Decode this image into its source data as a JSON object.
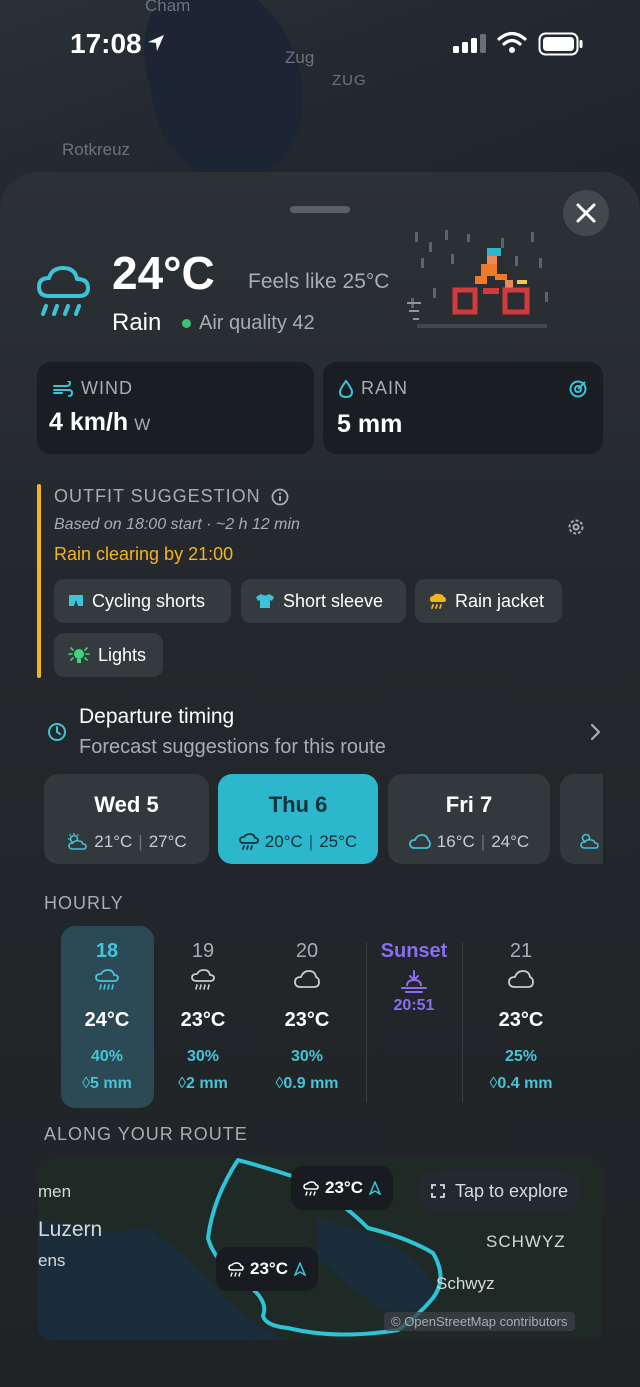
{
  "status_bar": {
    "time": "17:08"
  },
  "background_map": {
    "labels": [
      "Cham",
      "Zug",
      "ZUG",
      "Rotkreuz"
    ]
  },
  "current": {
    "temperature": "24°C",
    "feels_like": "Feels like 25°C",
    "condition": "Rain",
    "air_quality": "Air quality 42",
    "icon": "rain-cloud-icon"
  },
  "wind": {
    "label": "WIND",
    "value": "4 km/h",
    "direction": "W"
  },
  "rain": {
    "label": "RAIN",
    "value": "5 mm"
  },
  "outfit": {
    "title": "OUTFIT SUGGESTION",
    "subtitle": "Based on 18:00 start · ~2 h 12 min",
    "warning": "Rain clearing by 21:00",
    "chips": [
      {
        "label": "Cycling shorts",
        "icon": "shorts-icon"
      },
      {
        "label": "Short sleeve",
        "icon": "tshirt-icon"
      },
      {
        "label": "Rain jacket",
        "icon": "rain-jacket-icon"
      },
      {
        "label": "Lights",
        "icon": "light-icon"
      }
    ]
  },
  "departure": {
    "title": "Departure timing",
    "subtitle": "Forecast suggestions for this route"
  },
  "days": [
    {
      "name": "Wed 5",
      "low": "21°C",
      "high": "27°C",
      "icon": "sun-cloud-icon",
      "selected": false
    },
    {
      "name": "Thu 6",
      "low": "20°C",
      "high": "25°C",
      "icon": "rain-cloud-icon",
      "selected": true
    },
    {
      "name": "Fri 7",
      "low": "16°C",
      "high": "24°C",
      "icon": "cloud-icon",
      "selected": false
    }
  ],
  "hourly": {
    "title": "HOURLY",
    "hours": [
      {
        "time": "18",
        "temp": "24°C",
        "pct": "40%",
        "mm": "5 mm",
        "icon": "rain-cloud-icon"
      },
      {
        "time": "19",
        "temp": "23°C",
        "pct": "30%",
        "mm": "2 mm",
        "icon": "rain-cloud-icon"
      },
      {
        "time": "20",
        "temp": "23°C",
        "pct": "30%",
        "mm": "0.9 mm",
        "icon": "cloud-icon"
      },
      {
        "time": "21",
        "temp": "23°C",
        "pct": "25%",
        "mm": "0.4 mm",
        "icon": "cloud-icon"
      }
    ],
    "sunset": {
      "label": "Sunset",
      "time": "20:51"
    }
  },
  "route": {
    "title": "ALONG YOUR ROUTE",
    "bubble1": "23°C",
    "bubble2": "23°C",
    "explore": "Tap to explore",
    "labels": [
      "men",
      "Luzern",
      "ens",
      "SCHWYZ",
      "Schwyz"
    ],
    "attribution": "© OpenStreetMap contributors"
  },
  "colors": {
    "accent": "#2cb7cc",
    "warning": "#f2b51d",
    "sunset": "#8a6df0"
  }
}
